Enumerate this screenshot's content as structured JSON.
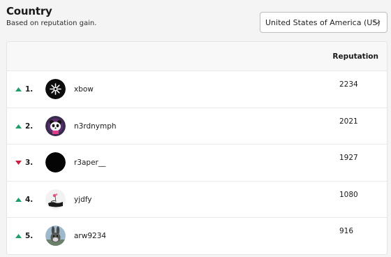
{
  "header": {
    "title": "Country",
    "subtitle": "Based on reputation gain."
  },
  "country_select": {
    "value": "United States of America (US)",
    "icon": "chevron-down-icon"
  },
  "table": {
    "columns": {
      "reputation": "Reputation"
    },
    "rows": [
      {
        "rank": "1.",
        "trend": "up",
        "trend_color": "#1f9d6b",
        "username": "xbow",
        "reputation": "2234",
        "avatar": "xbow-logo-avatar"
      },
      {
        "rank": "2.",
        "trend": "up",
        "trend_color": "#1f9d6b",
        "username": "n3rdnymph",
        "reputation": "2021",
        "avatar": "panda-avatar"
      },
      {
        "rank": "3.",
        "trend": "down",
        "trend_color": "#c8203c",
        "username": "r3aper__",
        "reputation": "1927",
        "avatar": "black-avatar"
      },
      {
        "rank": "4.",
        "trend": "up",
        "trend_color": "#1f9d6b",
        "username": "yjdfy",
        "reputation": "1080",
        "avatar": "ink-painting-avatar"
      },
      {
        "rank": "5.",
        "trend": "up",
        "trend_color": "#1f9d6b",
        "username": "arw9234",
        "reputation": "916",
        "avatar": "rabbit-avatar"
      }
    ]
  }
}
